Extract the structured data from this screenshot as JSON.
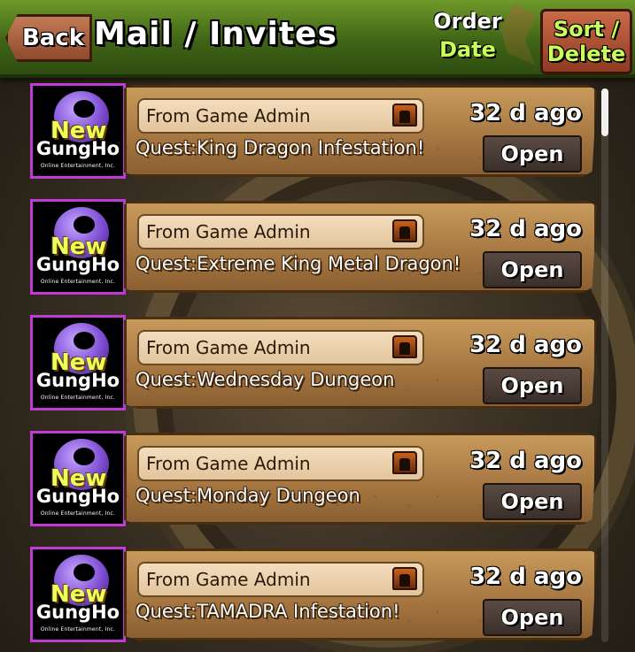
{
  "header": {
    "back_label": "Back",
    "title": "Mail / Invites",
    "order_line1": "Order",
    "order_line2": "Date",
    "sort_line1": "Sort /",
    "sort_line2": "Delete"
  },
  "colors": {
    "header_green": "#3f6416",
    "accent_lime": "#c8ff58",
    "avatar_border": "#c23ad6",
    "panel_tan": "#a57540"
  },
  "avatar": {
    "brand_new": "New",
    "brand_name": "GungHo",
    "brand_tagline": "Online Entertainment, Inc."
  },
  "mails": [
    {
      "from": "From Game Admin",
      "age": "32 d ago",
      "subject": "Quest:King Dragon Infestation!",
      "open_label": "Open",
      "icon": "treasure-chest-icon"
    },
    {
      "from": "From Game Admin",
      "age": "32 d ago",
      "subject": "Quest:Extreme King Metal Dragon!",
      "open_label": "Open",
      "icon": "treasure-chest-icon"
    },
    {
      "from": "From Game Admin",
      "age": "32 d ago",
      "subject": "Quest:Wednesday Dungeon",
      "open_label": "Open",
      "icon": "treasure-chest-icon"
    },
    {
      "from": "From Game Admin",
      "age": "32 d ago",
      "subject": "Quest:Monday Dungeon",
      "open_label": "Open",
      "icon": "treasure-chest-icon"
    },
    {
      "from": "From Game Admin",
      "age": "32 d ago",
      "subject": "Quest:TAMADRA Infestation!",
      "open_label": "Open",
      "icon": "treasure-chest-icon"
    }
  ]
}
